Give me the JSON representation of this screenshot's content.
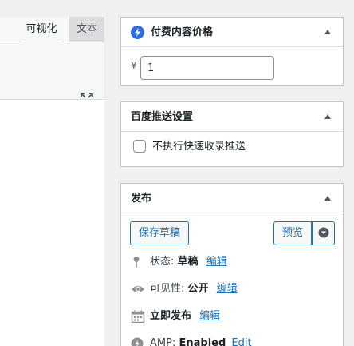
{
  "editor": {
    "tab_visual": "可视化",
    "tab_text": "文本",
    "expand_icon": "fullscreen-icon"
  },
  "price_box": {
    "title": "付费内容价格",
    "icon": "lightning-icon",
    "currency": "¥",
    "price_value": "1"
  },
  "baidu_box": {
    "title": "百度推送设置",
    "checkbox_label": "不执行快速收录推送",
    "checked": false
  },
  "publish_box": {
    "title": "发布",
    "save_draft": "保存草稿",
    "preview": "预览",
    "status_label": "状态:",
    "status_value": "草稿",
    "status_edit": "编辑",
    "visibility_label": "可见性:",
    "visibility_value": "公开",
    "visibility_edit": "编辑",
    "publish_label": "立即发布",
    "publish_edit": "编辑",
    "amp_label": "AMP:",
    "amp_value": "Enabled",
    "amp_edit": "Edit"
  },
  "colors": {
    "accent": "#2271b1",
    "panel_border": "#c3c4c7",
    "background": "#f0f0f1"
  }
}
